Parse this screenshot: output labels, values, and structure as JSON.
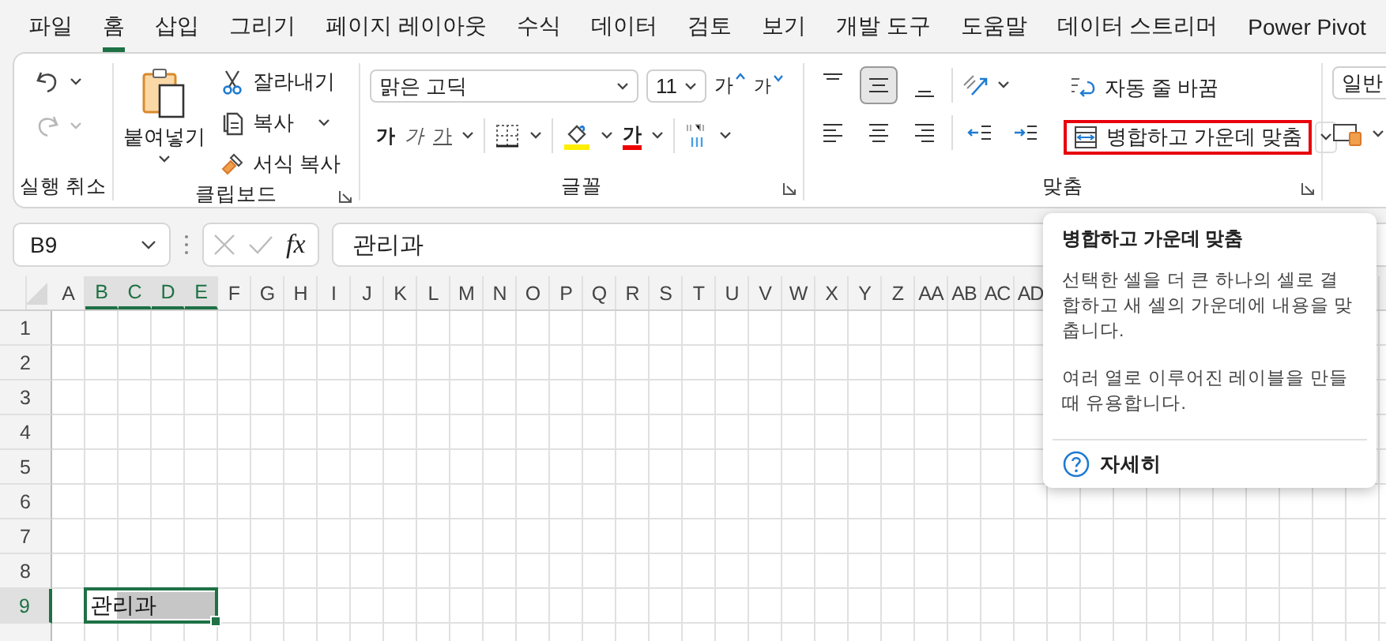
{
  "menu_tabs": [
    {
      "label": "파일",
      "selected": false
    },
    {
      "label": "홈",
      "selected": true
    },
    {
      "label": "삽입",
      "selected": false
    },
    {
      "label": "그리기",
      "selected": false
    },
    {
      "label": "페이지 레이아웃",
      "selected": false
    },
    {
      "label": "수식",
      "selected": false
    },
    {
      "label": "데이터",
      "selected": false
    },
    {
      "label": "검토",
      "selected": false
    },
    {
      "label": "보기",
      "selected": false
    },
    {
      "label": "개발 도구",
      "selected": false
    },
    {
      "label": "도움말",
      "selected": false
    },
    {
      "label": "데이터 스트리머",
      "selected": false
    },
    {
      "label": "Power Pivot",
      "selected": false
    }
  ],
  "undo": {
    "label": "실행 취소",
    "redo_disabled": true
  },
  "clipboard": {
    "label": "클립보드",
    "paste": "붙여넣기",
    "cut": "잘라내기",
    "copy": "복사",
    "format_painter": "서식 복사"
  },
  "font": {
    "label": "글꼴",
    "font_name": "맑은 고딕",
    "font_size": "11",
    "grow": "가",
    "shrink": "가",
    "bold": "가",
    "italic": "가",
    "underline": "가",
    "font_color": "가"
  },
  "alignment": {
    "label": "맞춤",
    "vertical": [
      {
        "kind": "top",
        "selected": false
      },
      {
        "kind": "middle",
        "selected": true
      },
      {
        "kind": "bottom",
        "selected": false
      }
    ],
    "wrap_text": "자동 줄 바꿈",
    "merge_center": {
      "label": "병합하고 가운데 맞춤",
      "highlighted": true
    }
  },
  "number": {
    "format": "일반"
  },
  "formula_bar": {
    "name_box": "B9",
    "function_label": "fx",
    "formula": "관리과"
  },
  "sheet": {
    "columns": [
      {
        "label": "A",
        "selected": false
      },
      {
        "label": "B",
        "selected": true
      },
      {
        "label": "C",
        "selected": true
      },
      {
        "label": "D",
        "selected": true
      },
      {
        "label": "E",
        "selected": true
      },
      {
        "label": "F",
        "selected": false
      },
      {
        "label": "G",
        "selected": false
      },
      {
        "label": "H",
        "selected": false
      },
      {
        "label": "I",
        "selected": false
      },
      {
        "label": "J",
        "selected": false
      },
      {
        "label": "K",
        "selected": false
      },
      {
        "label": "L",
        "selected": false
      },
      {
        "label": "M",
        "selected": false
      },
      {
        "label": "N",
        "selected": false
      },
      {
        "label": "O",
        "selected": false
      },
      {
        "label": "P",
        "selected": false
      },
      {
        "label": "Q",
        "selected": false
      },
      {
        "label": "R",
        "selected": false
      },
      {
        "label": "S",
        "selected": false
      },
      {
        "label": "T",
        "selected": false
      },
      {
        "label": "U",
        "selected": false
      },
      {
        "label": "V",
        "selected": false
      },
      {
        "label": "W",
        "selected": false
      },
      {
        "label": "X",
        "selected": false
      },
      {
        "label": "Y",
        "selected": false
      },
      {
        "label": "Z",
        "selected": false
      },
      {
        "label": "AA",
        "selected": false
      },
      {
        "label": "AB",
        "selected": false
      },
      {
        "label": "AC",
        "selected": false
      },
      {
        "label": "AD",
        "selected": false
      }
    ],
    "rows": [
      {
        "label": "1",
        "selected": false
      },
      {
        "label": "2",
        "selected": false
      },
      {
        "label": "3",
        "selected": false
      },
      {
        "label": "4",
        "selected": false
      },
      {
        "label": "5",
        "selected": false
      },
      {
        "label": "6",
        "selected": false
      },
      {
        "label": "7",
        "selected": false
      },
      {
        "label": "8",
        "selected": false
      },
      {
        "label": "9",
        "selected": true
      }
    ],
    "active_cell": {
      "value": "관리과"
    }
  },
  "tooltip": {
    "title": "병합하고 가운데 맞춤",
    "paragraphs": [
      "선택한 셀을 더 큰 하나의 셀로 결합하고 새 셀의 가운데에 내용을 맞춥니다.",
      "여러 열로 이루어진 레이블을 만들 때 유용합니다."
    ],
    "link": "자세히"
  }
}
